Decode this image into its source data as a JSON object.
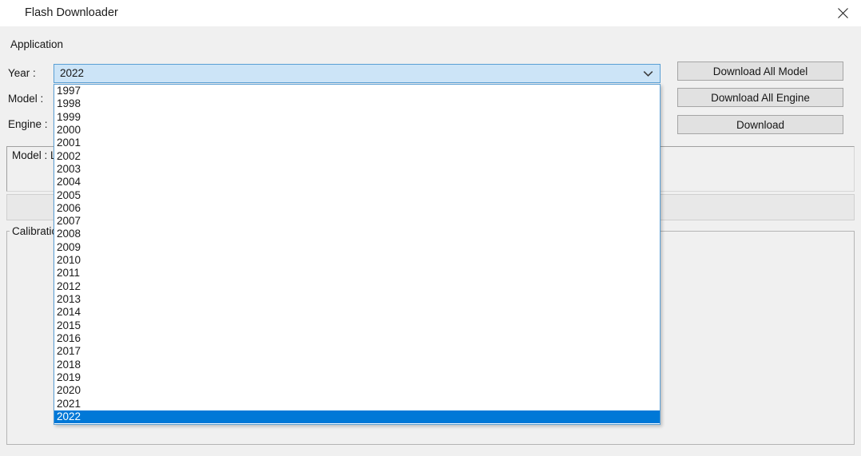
{
  "window": {
    "title": "Flash Downloader",
    "close_icon": "close-icon"
  },
  "application_group": {
    "label": "Application"
  },
  "fields": {
    "year_label": "Year :",
    "model_label": "Model :",
    "engine_label": "Engine :"
  },
  "year_combo": {
    "value": "2022",
    "arrow_icon": "chevron-down-icon",
    "expanded": true,
    "options": [
      "1997",
      "1998",
      "1999",
      "2000",
      "2001",
      "2002",
      "2003",
      "2004",
      "2005",
      "2006",
      "2007",
      "2008",
      "2009",
      "2010",
      "2011",
      "2012",
      "2013",
      "2014",
      "2015",
      "2016",
      "2017",
      "2018",
      "2019",
      "2020",
      "2021",
      "2022"
    ],
    "selected": "2022"
  },
  "model_combo": {
    "value": ""
  },
  "engine_combo": {
    "value": ""
  },
  "panels": {
    "model_info": "Model : L",
    "status": "",
    "calibration_label": "Calibration",
    "calibration_content": ""
  },
  "buttons": {
    "download_all_model": "Download All Model",
    "download_all_engine": "Download All Engine",
    "download": "Download"
  },
  "colors": {
    "accent": "#0078d7",
    "combo_focus_border": "#5a9fd4",
    "combo_focus_fill": "#cce4f7",
    "window_bg": "#f0f0f0",
    "titlebar_bg": "#ffffff"
  }
}
